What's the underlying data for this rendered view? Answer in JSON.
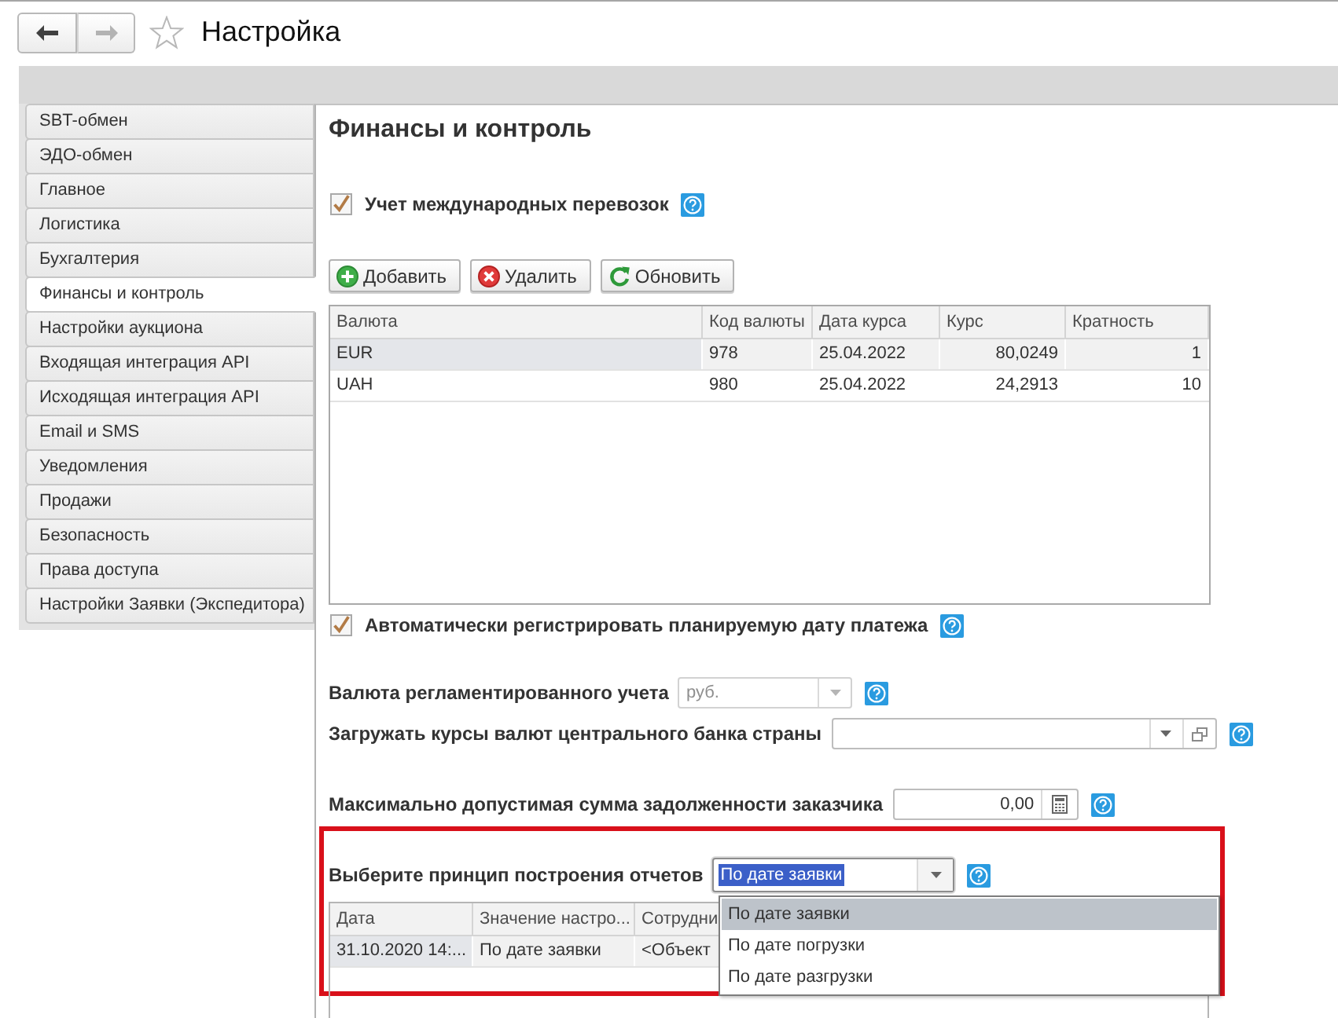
{
  "header": {
    "navigation": [
      {
        "kind": "back",
        "disabled": false
      },
      {
        "kind": "forward",
        "disabled": true
      }
    ],
    "favorite": false,
    "title": "Настройка"
  },
  "sidebar": {
    "items": [
      {
        "label": "SBT-обмен",
        "selected": false
      },
      {
        "label": "ЭДО-обмен",
        "selected": false
      },
      {
        "label": "Главное",
        "selected": false
      },
      {
        "label": "Логистика",
        "selected": false
      },
      {
        "label": "Бухгалтерия",
        "selected": false
      },
      {
        "label": "Финансы и контроль",
        "selected": true
      },
      {
        "label": "Настройки аукциона",
        "selected": false
      },
      {
        "label": "Входящая интеграция API",
        "selected": false
      },
      {
        "label": "Исходящая интеграция API",
        "selected": false
      },
      {
        "label": "Email и SMS",
        "selected": false
      },
      {
        "label": "Уведомления",
        "selected": false
      },
      {
        "label": "Продажи",
        "selected": false
      },
      {
        "label": "Безопасность",
        "selected": false
      },
      {
        "label": "Права доступа",
        "selected": false
      },
      {
        "label": "Настройки Заявки (Экспедитора)",
        "selected": false
      }
    ]
  },
  "section": {
    "title": "Финансы и контроль"
  },
  "international_transport": {
    "label": "Учет международных перевозок",
    "checked": true
  },
  "currency_toolbar": {
    "buttons": [
      {
        "kind": "add",
        "label": "Добавить"
      },
      {
        "kind": "delete",
        "label": "Удалить"
      },
      {
        "kind": "refresh",
        "label": "Обновить"
      }
    ]
  },
  "currency_table": {
    "columns": [
      {
        "label": "Валюта",
        "kind": "text"
      },
      {
        "label": "Код валюты",
        "kind": "text"
      },
      {
        "label": "Дата курса",
        "kind": "text"
      },
      {
        "label": "Курс",
        "kind": "number"
      },
      {
        "label": "Кратность",
        "kind": "number"
      }
    ],
    "rows": [
      {
        "selected": true,
        "cells": [
          "EUR",
          "978",
          "25.04.2022",
          "80,0249",
          "1"
        ]
      },
      {
        "selected": false,
        "cells": [
          "UAH",
          "980",
          "25.04.2022",
          "24,2913",
          "10"
        ]
      }
    ]
  },
  "auto_payment_date": {
    "label": "Автоматически регистрировать планируемую дату платежа",
    "checked": true
  },
  "field_groups": [
    {
      "fields": [
        {
          "kind": "select",
          "label": "Валюта регламентированного учета",
          "value": "руб.",
          "disabled": true
        },
        {
          "kind": "select_open",
          "label": "Загружать курсы валют центрального банка страны",
          "disabled": false
        }
      ]
    },
    {
      "fields": [
        {
          "kind": "number",
          "label": "Максимально допустимая сумма задолженности заказчика",
          "value": "0,00",
          "disabled": false
        }
      ]
    }
  ],
  "report_principle": {
    "highlighted": true,
    "label": "Выберите принцип построения отчетов",
    "value": "По дате заявки",
    "value_highlighted": true,
    "expanded": true,
    "options": [
      {
        "label": "По дате заявки",
        "selected": true
      },
      {
        "label": "По дате погрузки",
        "selected": false
      },
      {
        "label": "По дате разгрузки",
        "selected": false
      }
    ]
  },
  "history_table": {
    "columns": [
      "Дата",
      "Значение настро...",
      "Сотрудни"
    ],
    "rows": [
      {
        "selected": true,
        "cells": [
          "31.10.2020 14:...",
          "По дате заявки",
          "<Объект"
        ]
      }
    ]
  }
}
